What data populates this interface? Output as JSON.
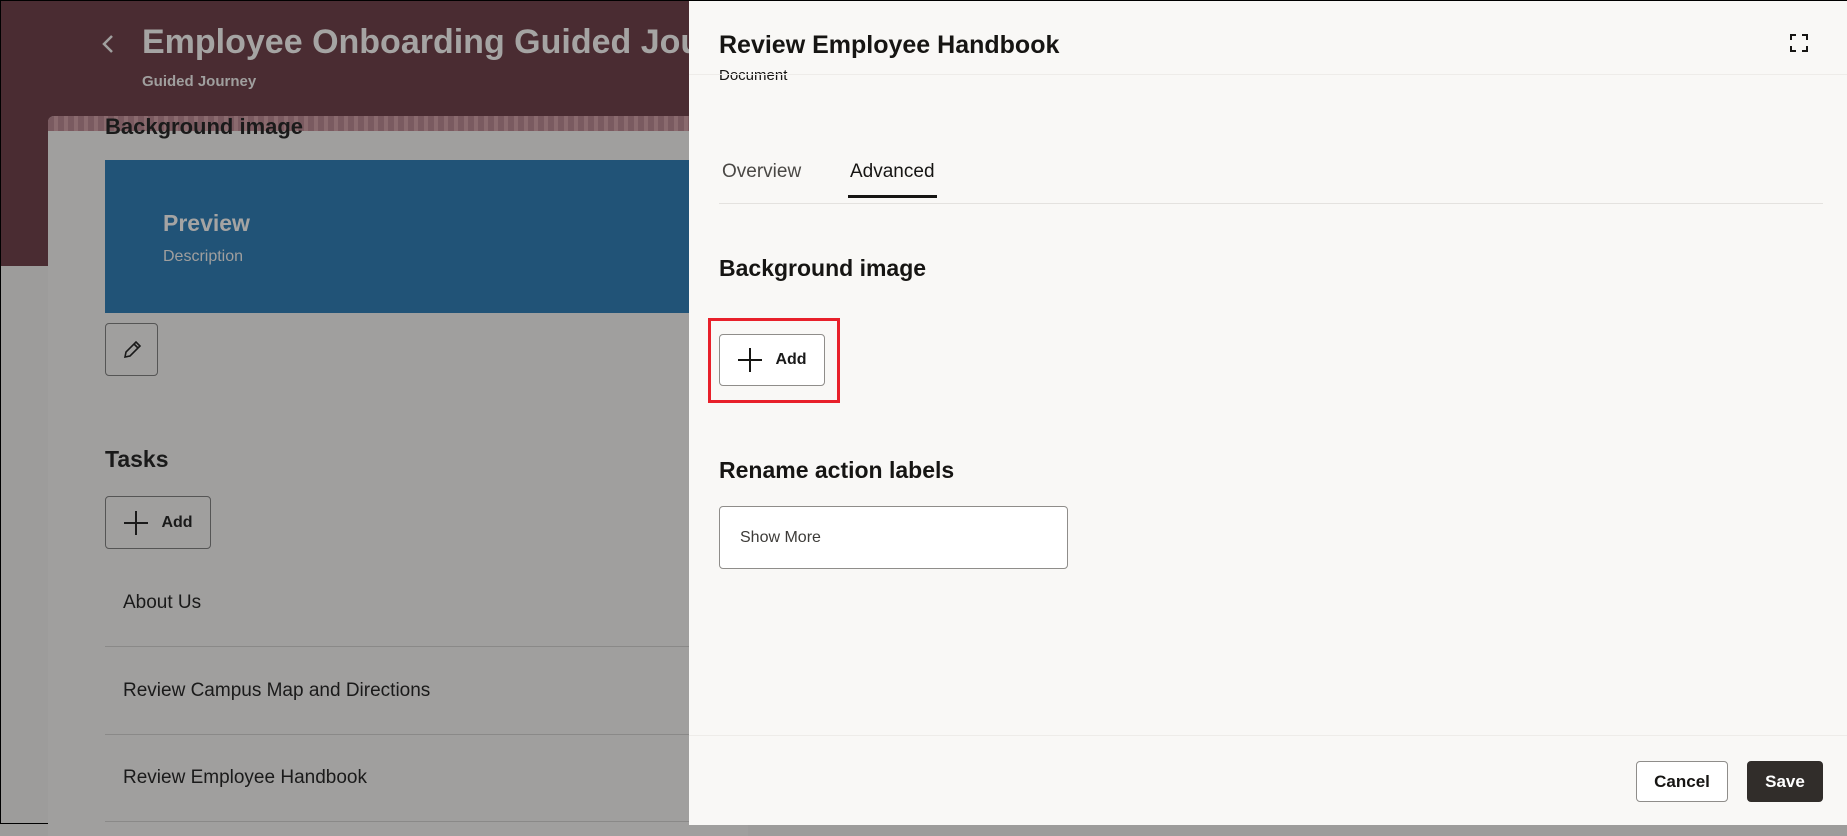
{
  "background_page": {
    "title": "Employee Onboarding Guided Jou",
    "subtitle": "Guided Journey",
    "section_heading": "Background image",
    "preview": {
      "title": "Preview",
      "description": "Description"
    },
    "tasks_heading": "Tasks",
    "add_label": "Add",
    "tasks": [
      "About Us",
      "Review Campus Map and Directions",
      "Review Employee Handbook"
    ]
  },
  "drawer": {
    "title": "Review Employee Handbook",
    "subtitle": "Document",
    "tabs": [
      {
        "label": "Overview",
        "active": false
      },
      {
        "label": "Advanced",
        "active": true
      }
    ],
    "background_image_heading": "Background image",
    "add_label": "Add",
    "rename_heading": "Rename action labels",
    "show_more_label": "Show More",
    "cancel_label": "Cancel",
    "save_label": "Save"
  },
  "colors": {
    "header": "#4a2c32",
    "preview": "#215377",
    "highlight": "#e8202a",
    "save": "#312d2a"
  }
}
